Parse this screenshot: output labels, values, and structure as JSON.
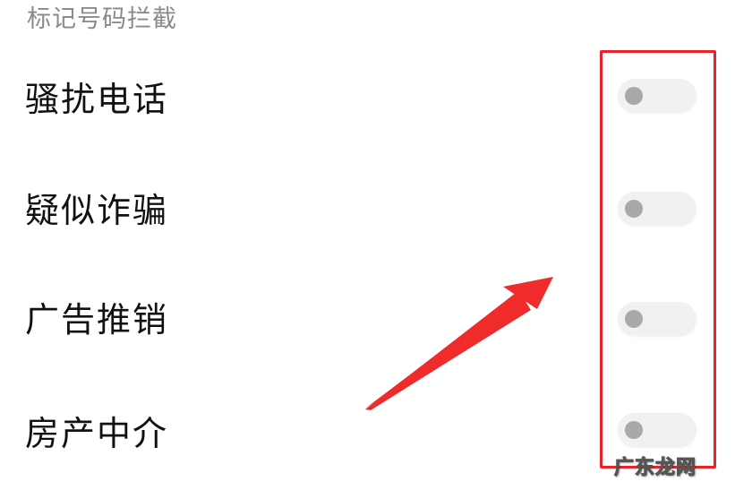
{
  "section": {
    "title": "标记号码拦截"
  },
  "items": [
    {
      "label": "骚扰电话",
      "enabled": false
    },
    {
      "label": "疑似诈骗",
      "enabled": false
    },
    {
      "label": "广告推销",
      "enabled": false
    },
    {
      "label": "房产中介",
      "enabled": false
    }
  ],
  "annotation": {
    "highlight_color": "#e8232a"
  },
  "watermark": {
    "text": "广东龙网"
  }
}
